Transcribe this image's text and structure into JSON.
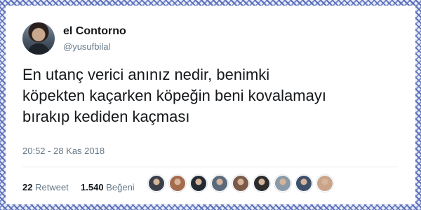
{
  "user": {
    "display_name": "el Contorno",
    "handle": "@yusufbilal"
  },
  "tweet": {
    "lines": [
      "En utanç verici anınız nedir, benimki",
      "köpekten kaçarken köpeğin beni kovalamayı",
      "bırakıp kediden kaçması"
    ],
    "timestamp": "20:52 - 28 Kas 2018"
  },
  "stats": {
    "retweet_count": "22",
    "retweet_label": "Retweet",
    "like_count": "1.540",
    "like_label": "Beğeni"
  },
  "likers": {
    "avatar_colors": [
      "#3a3f4a",
      "#a46b4e",
      "#222a33",
      "#5a6a7a",
      "#7b5a48",
      "#2c2c2c",
      "#8a9aa8",
      "#3d4f6a",
      "#c9a48a"
    ]
  },
  "colors": {
    "text_primary": "#14171a",
    "text_secondary": "#657786",
    "border_pattern": "#5b6fb5"
  }
}
